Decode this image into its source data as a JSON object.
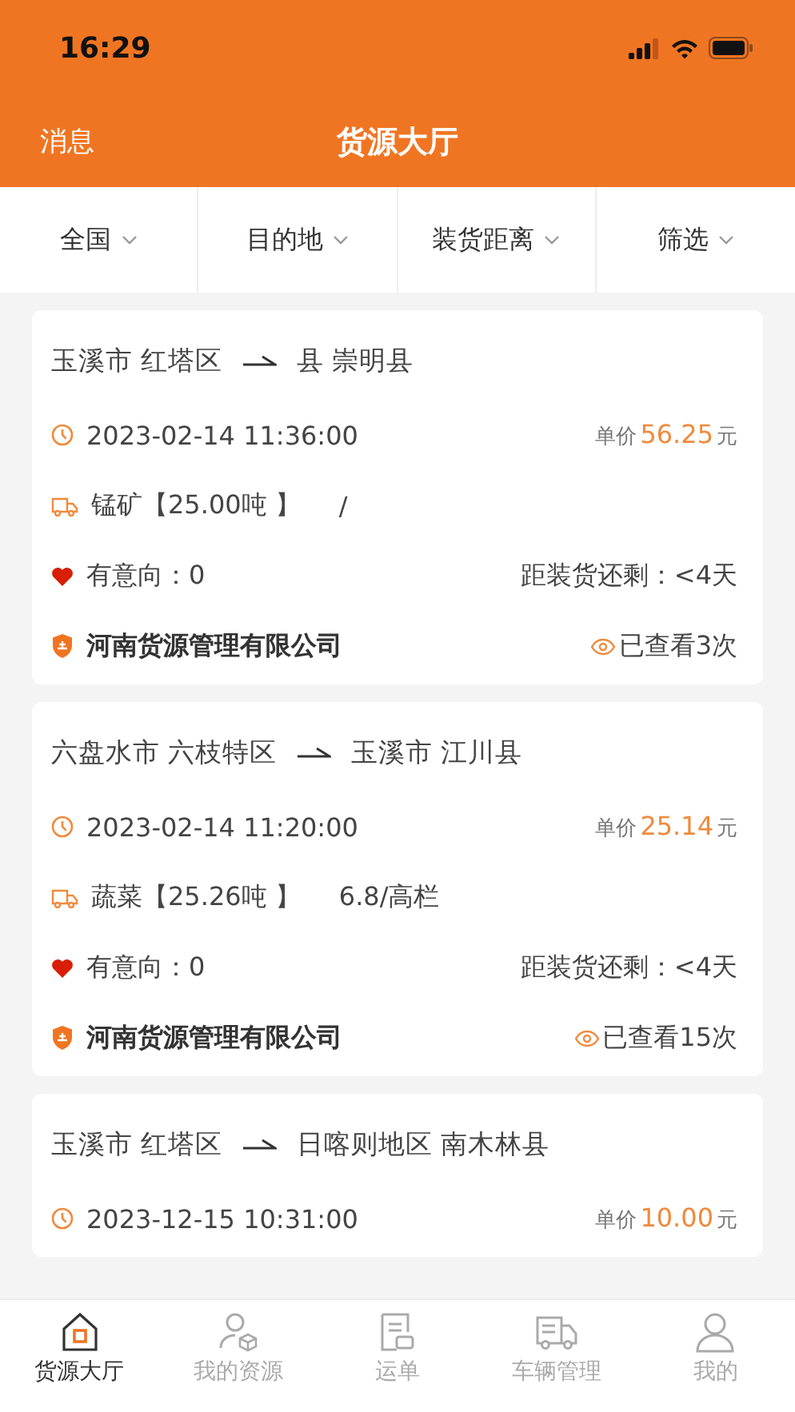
{
  "status_bar": {
    "time": "16:29"
  },
  "header": {
    "left": "消息",
    "title": "货源大厅"
  },
  "filters": [
    {
      "label": "全国"
    },
    {
      "label": "目的地"
    },
    {
      "label": "装货距离"
    },
    {
      "label": "筛选"
    }
  ],
  "cards": [
    {
      "origin": "玉溪市 红塔区",
      "destination": "县 崇明县",
      "time": "2023-02-14 11:36:00",
      "price_label": "单价",
      "price": "56.25",
      "price_unit": "元",
      "cargo": "锰矿【25.00吨 】",
      "vehicle": "/",
      "intent": "有意向：0",
      "remaining": "距装货还剩：<4天",
      "company": "河南货源管理有限公司",
      "views": "已查看3次"
    },
    {
      "origin": "六盘水市 六枝特区",
      "destination": "玉溪市 江川县",
      "time": "2023-02-14 11:20:00",
      "price_label": "单价",
      "price": "25.14",
      "price_unit": "元",
      "cargo": "蔬菜【25.26吨 】",
      "vehicle": "6.8/高栏",
      "intent": "有意向：0",
      "remaining": "距装货还剩：<4天",
      "company": "河南货源管理有限公司",
      "views": "已查看15次"
    },
    {
      "origin": "玉溪市 红塔区",
      "destination": "日喀则地区 南木林县",
      "time": "2023-12-15 10:31:00",
      "price_label": "单价",
      "price": "10.00",
      "price_unit": "元"
    }
  ],
  "tabs": [
    {
      "label": "货源大厅",
      "selected": true
    },
    {
      "label": "我的资源",
      "selected": false
    },
    {
      "label": "运单",
      "selected": false
    },
    {
      "label": "车辆管理",
      "selected": false
    },
    {
      "label": "我的",
      "selected": false
    }
  ]
}
